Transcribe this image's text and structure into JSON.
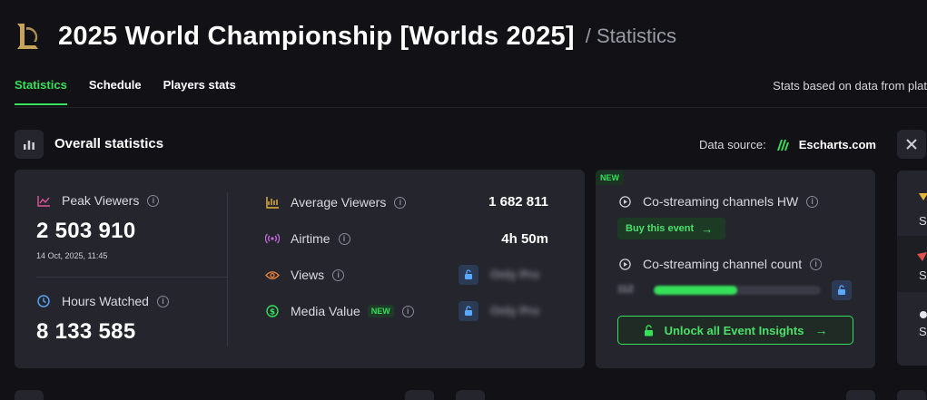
{
  "header": {
    "title": "2025 World Championship [Worlds 2025]",
    "breadcrumb": "/ Statistics",
    "logo_icon": "league-of-legends-logo"
  },
  "tabs": [
    {
      "label": "Statistics",
      "active": true
    },
    {
      "label": "Schedule",
      "active": false
    },
    {
      "label": "Players stats",
      "active": false
    }
  ],
  "stats_note": "Stats based on data from plat",
  "overall": {
    "title": "Overall statistics",
    "icon": "bar-chart-icon",
    "data_source_label": "Data source:",
    "data_source_brand": "Escharts.com"
  },
  "metrics": {
    "peak_viewers": {
      "label": "Peak Viewers",
      "value": "2 503 910",
      "date": "14 Oct, 2025, 11:45"
    },
    "hours_watched": {
      "label": "Hours Watched",
      "value": "8 133 585"
    },
    "average_viewers": {
      "label": "Average Viewers",
      "value": "1 682 811"
    },
    "airtime": {
      "label": "Airtime",
      "value": "4h 50m"
    },
    "views": {
      "label": "Views",
      "value": "Only Pro"
    },
    "media_value": {
      "label": "Media Value",
      "badge": "NEW",
      "value": "Only Pro"
    }
  },
  "costream": {
    "new_tag": "NEW",
    "hw_label": "Co-streaming channels HW",
    "buy_label": "Buy this event",
    "count_label": "Co-streaming channel count",
    "count_value": "112",
    "count_fill": 0.5,
    "unlock_label": "Unlock all Event Insights"
  },
  "right_partial": {
    "letters": [
      "S",
      "S",
      "S"
    ]
  },
  "colors": {
    "accent": "#35e05a",
    "card": "#25252d",
    "background": "#111116"
  }
}
